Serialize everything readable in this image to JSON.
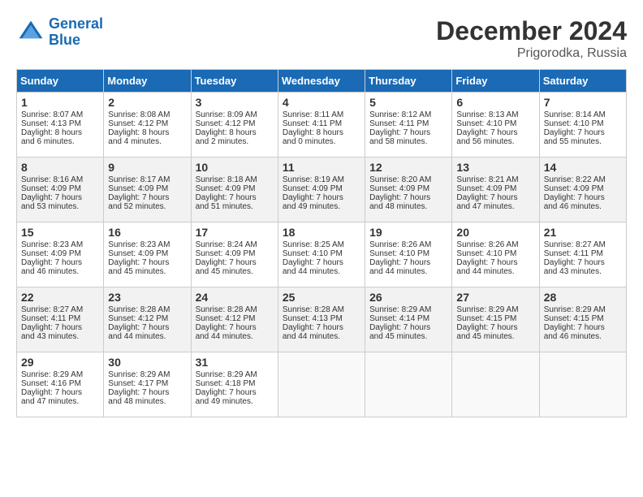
{
  "header": {
    "logo_line1": "General",
    "logo_line2": "Blue",
    "title": "December 2024",
    "subtitle": "Prigorodka, Russia"
  },
  "weekdays": [
    "Sunday",
    "Monday",
    "Tuesday",
    "Wednesday",
    "Thursday",
    "Friday",
    "Saturday"
  ],
  "weeks": [
    [
      {
        "day": "1",
        "lines": [
          "Sunrise: 8:07 AM",
          "Sunset: 4:13 PM",
          "Daylight: 8 hours",
          "and 6 minutes."
        ]
      },
      {
        "day": "2",
        "lines": [
          "Sunrise: 8:08 AM",
          "Sunset: 4:12 PM",
          "Daylight: 8 hours",
          "and 4 minutes."
        ]
      },
      {
        "day": "3",
        "lines": [
          "Sunrise: 8:09 AM",
          "Sunset: 4:12 PM",
          "Daylight: 8 hours",
          "and 2 minutes."
        ]
      },
      {
        "day": "4",
        "lines": [
          "Sunrise: 8:11 AM",
          "Sunset: 4:11 PM",
          "Daylight: 8 hours",
          "and 0 minutes."
        ]
      },
      {
        "day": "5",
        "lines": [
          "Sunrise: 8:12 AM",
          "Sunset: 4:11 PM",
          "Daylight: 7 hours",
          "and 58 minutes."
        ]
      },
      {
        "day": "6",
        "lines": [
          "Sunrise: 8:13 AM",
          "Sunset: 4:10 PM",
          "Daylight: 7 hours",
          "and 56 minutes."
        ]
      },
      {
        "day": "7",
        "lines": [
          "Sunrise: 8:14 AM",
          "Sunset: 4:10 PM",
          "Daylight: 7 hours",
          "and 55 minutes."
        ]
      }
    ],
    [
      {
        "day": "8",
        "lines": [
          "Sunrise: 8:16 AM",
          "Sunset: 4:09 PM",
          "Daylight: 7 hours",
          "and 53 minutes."
        ]
      },
      {
        "day": "9",
        "lines": [
          "Sunrise: 8:17 AM",
          "Sunset: 4:09 PM",
          "Daylight: 7 hours",
          "and 52 minutes."
        ]
      },
      {
        "day": "10",
        "lines": [
          "Sunrise: 8:18 AM",
          "Sunset: 4:09 PM",
          "Daylight: 7 hours",
          "and 51 minutes."
        ]
      },
      {
        "day": "11",
        "lines": [
          "Sunrise: 8:19 AM",
          "Sunset: 4:09 PM",
          "Daylight: 7 hours",
          "and 49 minutes."
        ]
      },
      {
        "day": "12",
        "lines": [
          "Sunrise: 8:20 AM",
          "Sunset: 4:09 PM",
          "Daylight: 7 hours",
          "and 48 minutes."
        ]
      },
      {
        "day": "13",
        "lines": [
          "Sunrise: 8:21 AM",
          "Sunset: 4:09 PM",
          "Daylight: 7 hours",
          "and 47 minutes."
        ]
      },
      {
        "day": "14",
        "lines": [
          "Sunrise: 8:22 AM",
          "Sunset: 4:09 PM",
          "Daylight: 7 hours",
          "and 46 minutes."
        ]
      }
    ],
    [
      {
        "day": "15",
        "lines": [
          "Sunrise: 8:23 AM",
          "Sunset: 4:09 PM",
          "Daylight: 7 hours",
          "and 46 minutes."
        ]
      },
      {
        "day": "16",
        "lines": [
          "Sunrise: 8:23 AM",
          "Sunset: 4:09 PM",
          "Daylight: 7 hours",
          "and 45 minutes."
        ]
      },
      {
        "day": "17",
        "lines": [
          "Sunrise: 8:24 AM",
          "Sunset: 4:09 PM",
          "Daylight: 7 hours",
          "and 45 minutes."
        ]
      },
      {
        "day": "18",
        "lines": [
          "Sunrise: 8:25 AM",
          "Sunset: 4:10 PM",
          "Daylight: 7 hours",
          "and 44 minutes."
        ]
      },
      {
        "day": "19",
        "lines": [
          "Sunrise: 8:26 AM",
          "Sunset: 4:10 PM",
          "Daylight: 7 hours",
          "and 44 minutes."
        ]
      },
      {
        "day": "20",
        "lines": [
          "Sunrise: 8:26 AM",
          "Sunset: 4:10 PM",
          "Daylight: 7 hours",
          "and 44 minutes."
        ]
      },
      {
        "day": "21",
        "lines": [
          "Sunrise: 8:27 AM",
          "Sunset: 4:11 PM",
          "Daylight: 7 hours",
          "and 43 minutes."
        ]
      }
    ],
    [
      {
        "day": "22",
        "lines": [
          "Sunrise: 8:27 AM",
          "Sunset: 4:11 PM",
          "Daylight: 7 hours",
          "and 43 minutes."
        ]
      },
      {
        "day": "23",
        "lines": [
          "Sunrise: 8:28 AM",
          "Sunset: 4:12 PM",
          "Daylight: 7 hours",
          "and 44 minutes."
        ]
      },
      {
        "day": "24",
        "lines": [
          "Sunrise: 8:28 AM",
          "Sunset: 4:12 PM",
          "Daylight: 7 hours",
          "and 44 minutes."
        ]
      },
      {
        "day": "25",
        "lines": [
          "Sunrise: 8:28 AM",
          "Sunset: 4:13 PM",
          "Daylight: 7 hours",
          "and 44 minutes."
        ]
      },
      {
        "day": "26",
        "lines": [
          "Sunrise: 8:29 AM",
          "Sunset: 4:14 PM",
          "Daylight: 7 hours",
          "and 45 minutes."
        ]
      },
      {
        "day": "27",
        "lines": [
          "Sunrise: 8:29 AM",
          "Sunset: 4:15 PM",
          "Daylight: 7 hours",
          "and 45 minutes."
        ]
      },
      {
        "day": "28",
        "lines": [
          "Sunrise: 8:29 AM",
          "Sunset: 4:15 PM",
          "Daylight: 7 hours",
          "and 46 minutes."
        ]
      }
    ],
    [
      {
        "day": "29",
        "lines": [
          "Sunrise: 8:29 AM",
          "Sunset: 4:16 PM",
          "Daylight: 7 hours",
          "and 47 minutes."
        ]
      },
      {
        "day": "30",
        "lines": [
          "Sunrise: 8:29 AM",
          "Sunset: 4:17 PM",
          "Daylight: 7 hours",
          "and 48 minutes."
        ]
      },
      {
        "day": "31",
        "lines": [
          "Sunrise: 8:29 AM",
          "Sunset: 4:18 PM",
          "Daylight: 7 hours",
          "and 49 minutes."
        ]
      },
      null,
      null,
      null,
      null
    ]
  ]
}
